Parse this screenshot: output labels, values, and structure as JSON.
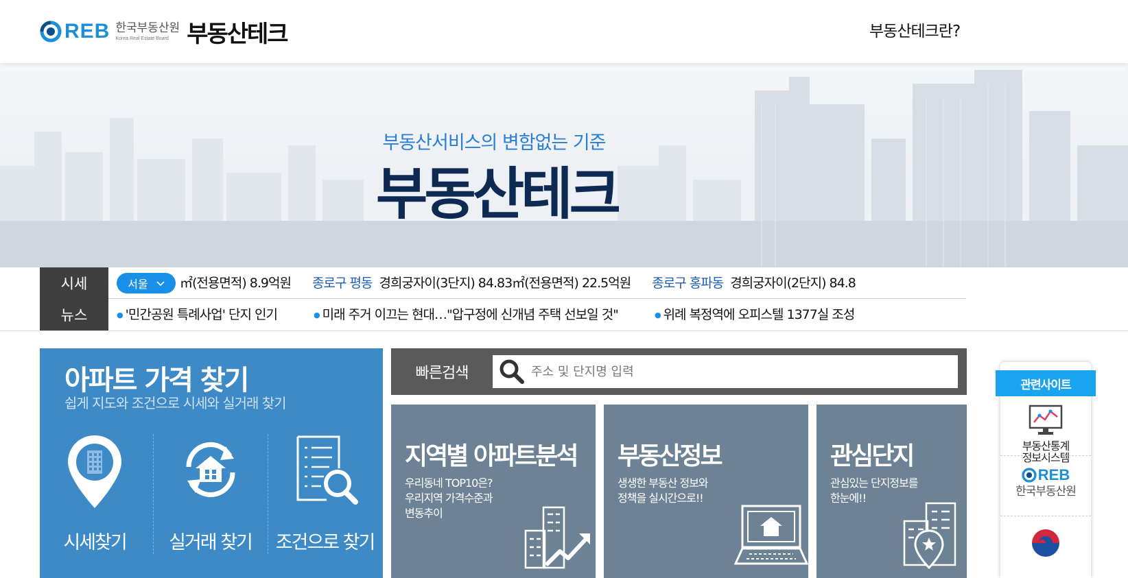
{
  "header": {
    "logo_reb": "REB",
    "logo_org_ko": "한국부동산원",
    "logo_org_en": "Korea Real Estate Board",
    "logo_brand": "부동산테크",
    "about_link": "부동산테크란?"
  },
  "hero": {
    "subtitle": "부동산서비스의 변함없는 기준",
    "title": "부동산테크"
  },
  "ticker": {
    "price_label": "시세",
    "region_selected": "서울",
    "price_items": [
      {
        "loc": "",
        "text": "㎡(전용면적)  8.9억원"
      },
      {
        "loc": "종로구  평동",
        "text": "경희궁자이(3단지)  84.83㎡(전용면적)  22.5억원"
      },
      {
        "loc": "종로구  홍파동",
        "text": "경희궁자이(2단지)  84.8"
      }
    ],
    "news_label": "뉴스",
    "news_items": [
      "'민간공원 특례사업' 단지 인기",
      "미래 주거 이끄는 현대…\"압구정에 신개념 주택 선보일 것\"",
      "위례 복정역에 오피스텔 1377실 조성"
    ]
  },
  "apartment": {
    "title": "아파트 가격 찾기",
    "subtitle": "쉽게 지도와 조건으로 시세와 실거래 찾기",
    "options": [
      {
        "label": "시세찾기",
        "icon": "map-pin-building-icon"
      },
      {
        "label": "실거래 찾기",
        "icon": "house-cycle-icon"
      },
      {
        "label": "조건으로 찾기",
        "icon": "document-search-icon"
      }
    ]
  },
  "quick_search": {
    "label": "빠른검색",
    "placeholder": "주소 및 단지명 입력"
  },
  "tiles": [
    {
      "title": "지역별 아파트분석",
      "desc": "우리동네 TOP10은?\n우리지역 가격수준과\n변동추이",
      "icon": "buildings-chart-icon"
    },
    {
      "title": "부동산정보",
      "desc": "생생한 부동산 정보와\n정책을 실시간으로!!",
      "icon": "laptop-house-icon"
    },
    {
      "title": "관심단지",
      "desc": "관심있는 단지정보를\n한눈에!!",
      "icon": "building-pin-icon"
    }
  ],
  "related": {
    "tab": "관련사이트",
    "items": [
      {
        "label": "부동산통계\n정보시스템",
        "icon": "stats-monitor-icon"
      },
      {
        "label": "한국부동산원",
        "icon": "reb-logo-icon"
      }
    ],
    "partial_icon": "government-emblem-icon"
  },
  "colors": {
    "accent_blue": "#1a8fe8",
    "panel_blue": "#3d8ac6",
    "tile_grey": "#6e8295",
    "hero_title": "#0e2a52"
  }
}
